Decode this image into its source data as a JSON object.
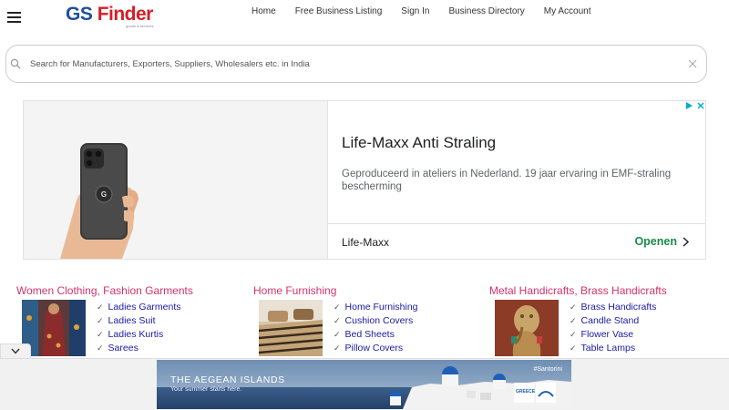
{
  "header": {
    "logo_gs": "GS",
    "logo_finder": "Finder",
    "logo_tagline": "goods & services",
    "nav": [
      "Home",
      "Free Business Listing",
      "Sign In",
      "Business Directory",
      "My Account"
    ]
  },
  "search": {
    "placeholder": "Search for Manufacturers, Exporters, Suppliers, Wholesalers etc. in India"
  },
  "ad": {
    "title": "Life-Maxx Anti Straling",
    "description": "Geproduceerd in ateliers in Nederland. 19 jaar ervaring in EMF-straling bescherming",
    "brand": "Life-Maxx",
    "cta": "Openen",
    "accent_color": "#1a8a4d"
  },
  "categories": [
    {
      "title": "Women Clothing, Fashion Garments",
      "items": [
        "Ladies Garments",
        "Ladies Suit",
        "Ladies Kurtis",
        "Sarees"
      ]
    },
    {
      "title": "Home Furnishing",
      "items": [
        "Home Furnishing",
        "Cushion Covers",
        "Bed Sheets",
        "Pillow Covers"
      ]
    },
    {
      "title": "Metal Handicrafts, Brass Handicrafts",
      "items": [
        "Brass Handicrafts",
        "Candle Stand",
        "Flower Vase",
        "Table Lamps"
      ]
    }
  ],
  "banner": {
    "title": "THE AEGEAN ISLANDS",
    "subtitle": "Your summer starts here.",
    "tag": "#Santorini",
    "logo_text": "GREECE"
  },
  "colors": {
    "category_title": "#d2336b",
    "category_link": "#1a1aa6",
    "logo_blue": "#1f4e9e",
    "logo_red": "#d42027"
  }
}
